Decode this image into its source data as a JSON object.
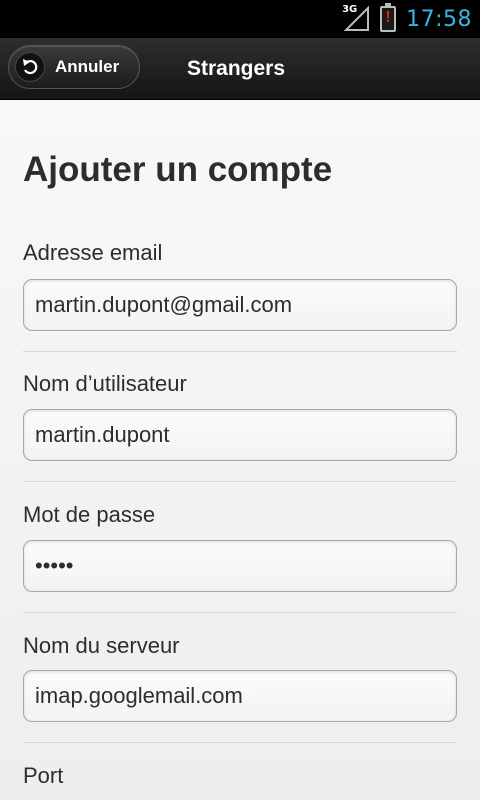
{
  "status_bar": {
    "network": "3G",
    "time": "17:58"
  },
  "action_bar": {
    "cancel_label": "Annuler",
    "app_title": "Strangers"
  },
  "form": {
    "title": "Ajouter un compte",
    "fields": [
      {
        "label": "Adresse email",
        "value": "martin.dupont@gmail.com"
      },
      {
        "label": "Nom d’utilisateur",
        "value": "martin.dupont"
      },
      {
        "label": "Mot de passe",
        "value": "•••••"
      },
      {
        "label": "Nom du serveur",
        "value": "imap.googlemail.com"
      },
      {
        "label": "Port"
      }
    ]
  },
  "colors": {
    "clock": "#35b5e5",
    "battery_alert": "#e02020"
  },
  "icons": [
    "signal-icon",
    "battery-alert-icon",
    "back-arrow-icon"
  ]
}
